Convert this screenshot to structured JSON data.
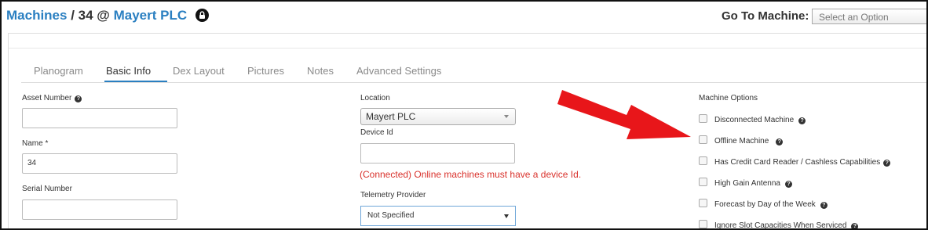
{
  "header": {
    "breadcrumb_root": "Machines",
    "breadcrumb_rest": " / 34 @ ",
    "location_link": "Mayert PLC",
    "goto_label": "Go To Machine:",
    "goto_placeholder": "Select an Option"
  },
  "tabs": [
    "Planogram",
    "Basic Info",
    "Dex Layout",
    "Pictures",
    "Notes",
    "Advanced Settings"
  ],
  "active_tab": "Basic Info",
  "form": {
    "asset_number_label": "Asset Number",
    "asset_number_value": "",
    "name_label": "Name *",
    "name_value": "34",
    "serial_number_label": "Serial Number",
    "serial_number_value": "",
    "location_label": "Location",
    "location_value": "Mayert PLC",
    "device_id_label": "Device Id",
    "device_id_value": "",
    "device_id_error": "(Connected) Online machines must have a device Id.",
    "telemetry_label": "Telemetry Provider",
    "telemetry_value": "Not Specified"
  },
  "machine_options": {
    "title": "Machine Options",
    "items": [
      {
        "label": "Disconnected Machine",
        "checked": false
      },
      {
        "label": "Offline Machine",
        "checked": false
      },
      {
        "label": "Has Credit Card Reader / Cashless Capabilities",
        "checked": false
      },
      {
        "label": "High Gain Antenna",
        "checked": false
      },
      {
        "label": "Forecast by Day of the Week",
        "checked": false
      },
      {
        "label": "Ignore Slot Capacities When Serviced",
        "checked": false
      }
    ]
  },
  "colors": {
    "link": "#2a7fc1",
    "error": "#d9312b",
    "annotation_arrow": "#e8161a"
  },
  "icons": {
    "lock": "lock-icon",
    "help": "help-icon",
    "annotation": "red-arrow-annotation"
  }
}
